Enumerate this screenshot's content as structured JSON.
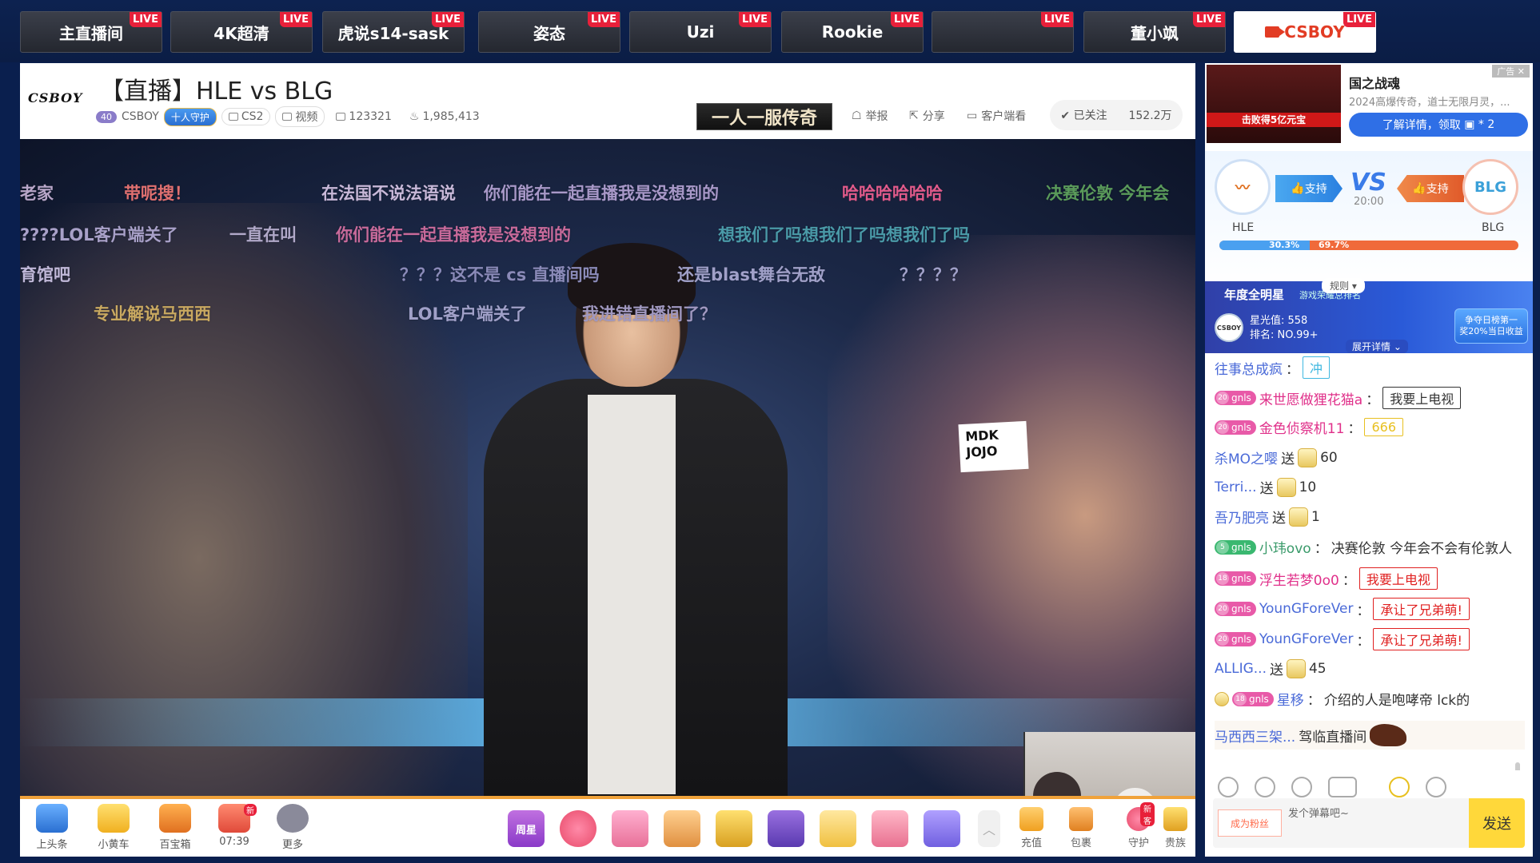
{
  "top_tabs": [
    {
      "label": "主直播间",
      "live": "LIVE"
    },
    {
      "label": "4K超清",
      "live": "LIVE"
    },
    {
      "label": "虎说s14-sask",
      "live": "LIVE"
    },
    {
      "label": "姿态",
      "live": "LIVE"
    },
    {
      "label": "Uzi",
      "live": "LIVE"
    },
    {
      "label": "Rookie",
      "live": "LIVE"
    },
    {
      "label": "",
      "live": "LIVE"
    },
    {
      "label": "董小飒",
      "live": "LIVE"
    },
    {
      "label": "CSBOY",
      "live": "LIVE"
    }
  ],
  "room": {
    "logo": "CSBOY",
    "title": "【直播】HLE vs BLG",
    "host_level": "40",
    "host": "CSBOY",
    "guard_badge": "十人守护",
    "game": "CS2",
    "video": "视频",
    "room_id": "123321",
    "heat": "1,985,413",
    "banner": "一人一服传奇",
    "report": "举报",
    "share": "分享",
    "client": "客户端看",
    "follow": "已关注",
    "followers": "152.2万"
  },
  "danmu": [
    "老家",
    "带呢搜！",
    "在法国不说法语说",
    "你们能在一起直播我是没想到的",
    "哈哈哈哈哈哈",
    "决赛伦敦 今年会",
    "????LOL客户端关了",
    "一直在叫",
    "你们能在一起直播我是没想到的",
    "想我们了吗想我们了吗想我们了吗",
    "育馆吧",
    "？？？这不是 cs 直播间吗",
    "还是blast舞台无敌",
    "？？？？",
    "专业解说马西西",
    "LOL客户端关了",
    "我进错直播间了？"
  ],
  "video": {
    "sign_text": "MDK JOJO"
  },
  "toolbar": {
    "left": [
      {
        "label": "上头条"
      },
      {
        "label": "小黄车"
      },
      {
        "label": "百宝箱"
      },
      {
        "label": "07:39",
        "tag": "新"
      },
      {
        "label": "更多"
      }
    ],
    "right": [
      {
        "label": "充值"
      },
      {
        "label": "包裹"
      },
      {
        "label": "守护",
        "tag": "新客"
      },
      {
        "label": "贵族"
      }
    ],
    "gift_label": "周星"
  },
  "ad": {
    "tag": "广告",
    "image_strip": "击败得5亿元宝",
    "title": "国之战魂",
    "subtitle": "2024高爆传奇，道士无限月灵，...",
    "button": "了解详情，领取",
    "button_count": "2"
  },
  "match": {
    "team_a": "HLE",
    "team_b": "BLG",
    "support": "支持",
    "vs": "VS",
    "time": "20:00",
    "pct_a": "30.3%",
    "pct_b": "69.7%",
    "pct_a_value": 30.3
  },
  "star": {
    "title": "年度全明星",
    "subtitle": "游戏荣耀总排名",
    "rule": "规则",
    "avatar": "CSBOY",
    "points": "星光值: 558",
    "rank": "排名: NO.99+",
    "cta1": "争夺日榜第一",
    "cta2": "奖20%当日收益",
    "expand": "展开详情"
  },
  "chat": [
    {
      "user": "往事总成疯",
      "sep": "：",
      "emote": "冲"
    },
    {
      "level": "20",
      "fan": "gnls",
      "user": "来世愿做狸花猫a",
      "sep": "：",
      "emote": "我要上电视"
    },
    {
      "level": "20",
      "fan": "gnls",
      "user": "金色侦察机11",
      "sep": "：",
      "emote": "666"
    },
    {
      "user": "杀MO之嘤",
      "action": "送",
      "count": "60"
    },
    {
      "user": "Terri...",
      "action": "送",
      "count": "10"
    },
    {
      "user": "吾乃肥亮",
      "action": "送",
      "count": "1"
    },
    {
      "level": "5",
      "fan": "gnls",
      "user": "小玮ovo",
      "sep": "：",
      "text": "决赛伦敦 今年会不会有伦敦人"
    },
    {
      "level": "18",
      "fan": "gnls",
      "user": "浮生若梦0o0",
      "sep": "：",
      "emote": "我要上电视"
    },
    {
      "level": "20",
      "fan": "gnls",
      "user": "YounGForeVer",
      "sep": "：",
      "emote": "承让了兄弟萌!"
    },
    {
      "level": "20",
      "fan": "gnls",
      "user": "YounGForeVer",
      "sep": "：",
      "emote": "承让了兄弟萌!"
    },
    {
      "user": "ALLIG...",
      "action": "送",
      "count": "45"
    },
    {
      "level": "18",
      "fan": "gnls",
      "user": "星移",
      "sep": "：",
      "text": "介绍的人是咆哮帝 lck的"
    },
    {
      "user": "马西西三架...",
      "text": "驾临直播间"
    }
  ],
  "input": {
    "fans_btn": "成为粉丝",
    "placeholder": "发个弹幕吧~",
    "send": "发送"
  },
  "colors": {
    "live_badge": "#e8203a",
    "accent_orange": "#f0a23a",
    "send_yellow": "#ffd83a",
    "blue": "#2f6fe6"
  }
}
